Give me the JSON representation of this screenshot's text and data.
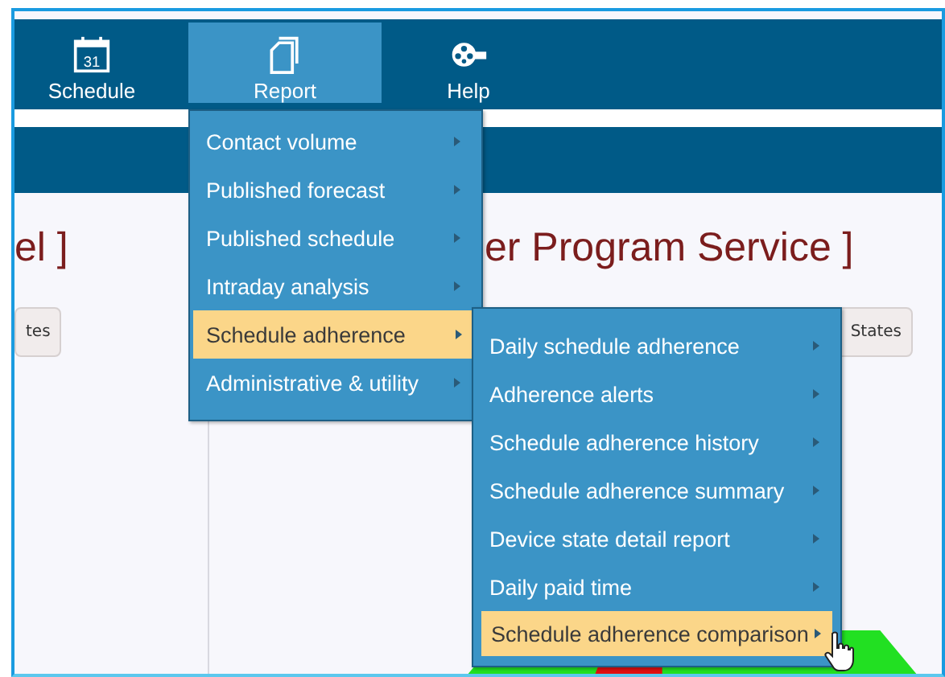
{
  "nav": {
    "items": [
      {
        "label": "Schedule",
        "kind": "calendar",
        "icon_text": "31",
        "selected": false
      },
      {
        "label": "Report",
        "kind": "pages",
        "selected": true
      },
      {
        "label": "Help",
        "kind": "reel",
        "selected": false
      }
    ]
  },
  "content": {
    "titles": [
      "el ]",
      "er Program Service ]"
    ],
    "buttons": [
      "tes",
      "States"
    ]
  },
  "menu": {
    "items": [
      {
        "label": "Contact volume",
        "selected": false
      },
      {
        "label": "Published forecast",
        "selected": false
      },
      {
        "label": "Published schedule",
        "selected": false
      },
      {
        "label": "Intraday analysis",
        "selected": false
      },
      {
        "label": "Schedule adherence",
        "selected": true
      },
      {
        "label": "Administrative & utility",
        "selected": false
      }
    ]
  },
  "submenu": {
    "items": [
      {
        "label": "Daily schedule adherence",
        "selected": false
      },
      {
        "label": "Adherence alerts",
        "selected": false
      },
      {
        "label": "Schedule adherence history",
        "selected": false
      },
      {
        "label": "Schedule adherence summary",
        "selected": false
      },
      {
        "label": "Device state detail report",
        "selected": false
      },
      {
        "label": "Daily paid time",
        "selected": false
      },
      {
        "label": "Schedule adherence comparison",
        "selected": true
      }
    ]
  }
}
